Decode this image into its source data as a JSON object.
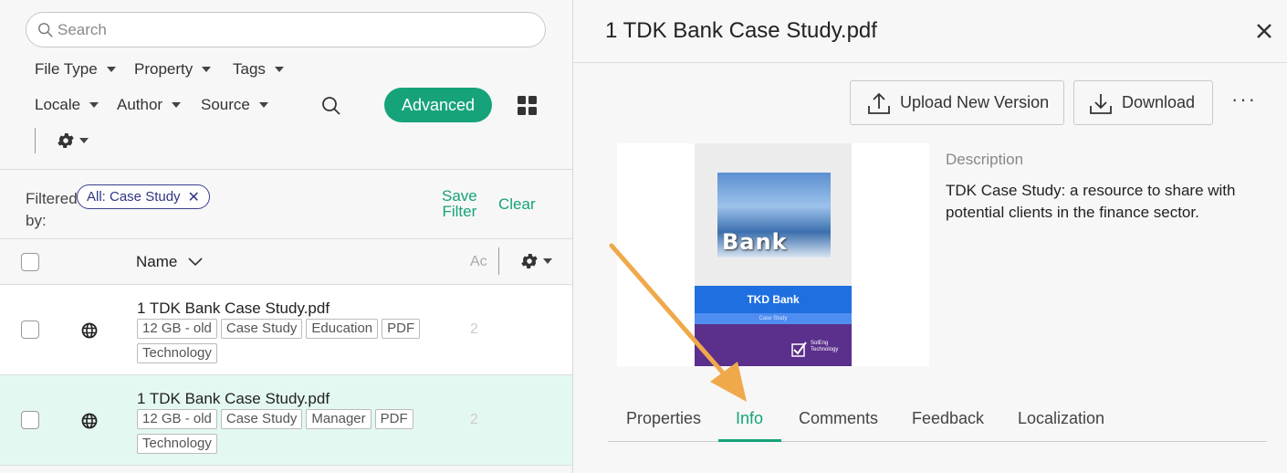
{
  "search": {
    "placeholder": "Search"
  },
  "filters": {
    "file_type": "File Type",
    "property": "Property",
    "tags": "Tags",
    "locale": "Locale",
    "author": "Author",
    "source": "Source",
    "advanced": "Advanced"
  },
  "filterbar": {
    "filtered_by": "Filtered by:",
    "chip_label": "All: Case Study",
    "chip_remove": "✕",
    "save_filter_line1": "Save",
    "save_filter_line2": "Filter",
    "clear": "Clear"
  },
  "table": {
    "col_name": "Name",
    "col_ac": "Ac",
    "rows": [
      {
        "title": "1 TDK Bank Case Study.pdf",
        "tags": [
          "12 GB - old",
          "Case Study",
          "Education",
          "PDF",
          "Technology"
        ],
        "ac": "2",
        "selected": false
      },
      {
        "title": "1 TDK Bank Case Study.pdf",
        "tags": [
          "12 GB - old",
          "Case Study",
          "Manager",
          "PDF",
          "Technology"
        ],
        "ac": "2",
        "selected": true
      }
    ]
  },
  "detail": {
    "title": "1 TDK Bank Case Study.pdf",
    "upload_label": "Upload New Version",
    "download_label": "Download",
    "more_label": "···",
    "preview": {
      "photo_word": "Bank",
      "bank_name": "TKD Bank",
      "subtitle": "Case Study",
      "logo_text": "SolEng Technology"
    },
    "description_label": "Description",
    "description_text": "TDK Case Study: a resource to share with potential clients in the finance sector.",
    "tabs": [
      "Properties",
      "Info",
      "Comments",
      "Feedback",
      "Localization"
    ],
    "active_tab": "Info"
  },
  "colors": {
    "accent": "#16a37a",
    "chip": "#2e3585",
    "annotation_arrow": "#f0a94a"
  }
}
